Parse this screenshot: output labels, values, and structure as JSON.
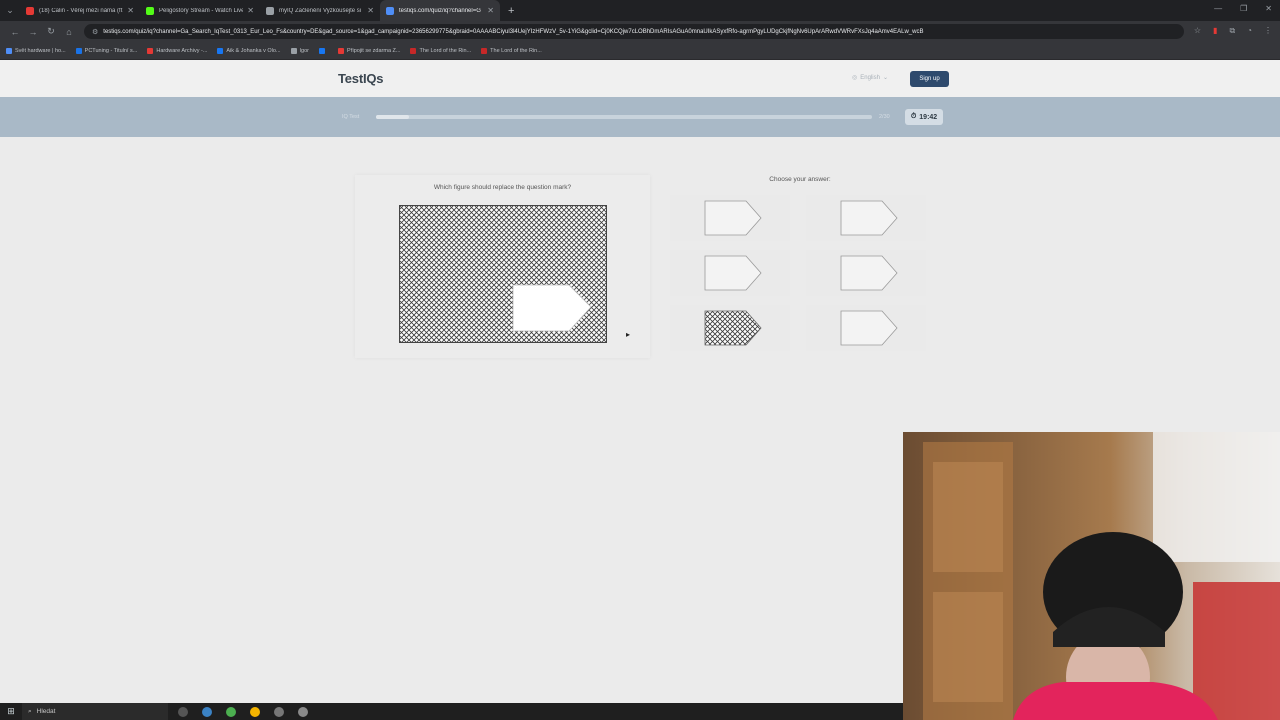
{
  "browser": {
    "tabs": [
      {
        "title": "(18) Calin - Věrej mezi náma (ft",
        "fav_color": "#e53935",
        "active": false
      },
      {
        "title": "Peligostory Stream - Watch Live",
        "fav_color": "#53fc18",
        "active": false
      },
      {
        "title": "myIQ Začlenění Vyzkoušejte si",
        "fav_color": "#9aa0a6",
        "active": false
      },
      {
        "title": "testiqs.com/quiz/iq?channel=G",
        "fav_color": "#4f8ef7",
        "active": true
      }
    ],
    "url": "testiqs.com/quiz/iq?channel=Ga_Search_IqTest_0313_Eur_Leo_Fs&country=DE&gad_source=1&gad_campaignid=23656299775&gbraid=0AAAABCiyul3l4UejYIzHFWzV_5v-1YiG&gclid=Cj0KCQjw7cLOBhDmARIsAGuA0mnaUIkASyxfRfo-agrmPgyLUDgCkjfNgNv6UpArARwdVWRvFXsJq4aAmv4EALw_wcB",
    "bookmarks": [
      {
        "label": "Svět hardware | ho...",
        "color": "#4f8ef7"
      },
      {
        "label": "PCTuning - Titulní s...",
        "color": "#1a73e8"
      },
      {
        "label": "Hardware Archivy -...",
        "color": "#e53935"
      },
      {
        "label": "Aik & Johanka v Olo...",
        "color": "#1877f2"
      },
      {
        "label": "Igor",
        "color": "#9aa0a6"
      },
      {
        "label": "",
        "color": "#1877f2"
      },
      {
        "label": "Připojit se zdarma Z...",
        "color": "#e53935"
      },
      {
        "label": "The Lord of the Rin...",
        "color": "#c62828"
      },
      {
        "label": "The Lord of the Rin...",
        "color": "#c62828"
      }
    ]
  },
  "site": {
    "logo": "TestIQs",
    "language": "English",
    "signup_label": "Sign up",
    "progress_label": "IQ Test",
    "progress_count": "2/30",
    "progress_fraction": 0.067,
    "timer": "19:42"
  },
  "question": {
    "prompt": "Which figure should replace the question mark?"
  },
  "answers": {
    "title": "Choose your answer:",
    "options": [
      {
        "fill": "plain"
      },
      {
        "fill": "plain"
      },
      {
        "fill": "plain"
      },
      {
        "fill": "plain"
      },
      {
        "fill": "hatched"
      },
      {
        "fill": "plain"
      }
    ]
  },
  "taskbar": {
    "search_placeholder": "Hledat"
  },
  "colors": {
    "accent": "#2e4a6d",
    "progress_band": "#a9b9c7"
  }
}
